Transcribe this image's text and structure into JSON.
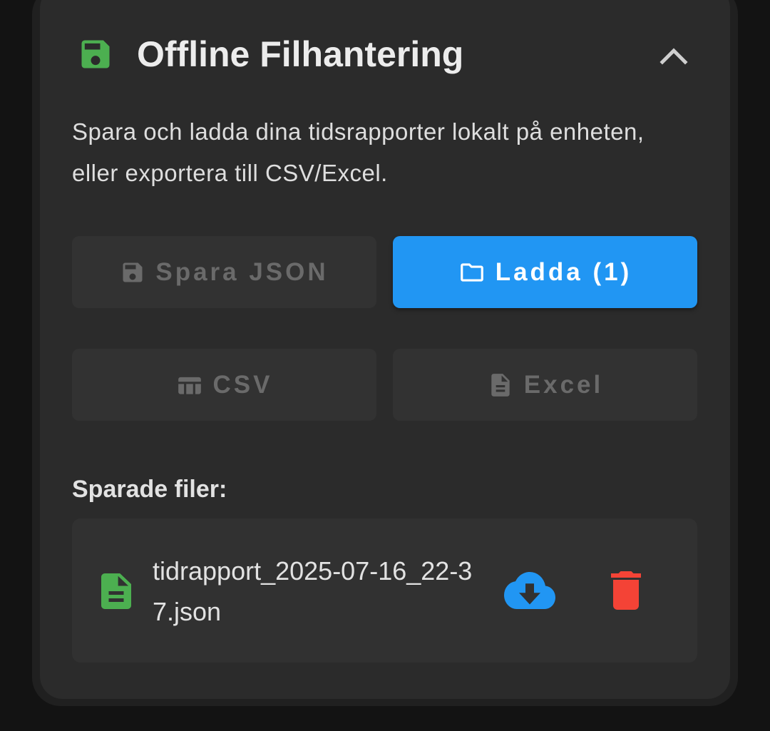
{
  "panel": {
    "title": "Offline Filhantering",
    "description": "Spara och ladda dina tidsrapporter lokalt på enheten, eller exportera till CSV/Excel.",
    "header_icon": "floppy-disk-icon",
    "collapse_icon": "chevron-up-icon"
  },
  "buttons": {
    "save_json": {
      "label": "Spara JSON",
      "icon": "floppy-disk-icon",
      "state": "disabled"
    },
    "load": {
      "label": "Ladda (1)",
      "icon": "folder-icon",
      "state": "enabled"
    },
    "csv": {
      "label": "CSV",
      "icon": "table-icon",
      "state": "disabled"
    },
    "excel": {
      "label": "Excel",
      "icon": "document-icon",
      "state": "disabled"
    }
  },
  "saved_files": {
    "heading": "Sparade filer:",
    "items": [
      {
        "name": "tidrapport_2025-07-16_22-37.json",
        "icon": "file-document-icon",
        "download_icon": "cloud-download-icon",
        "delete_icon": "trash-icon"
      }
    ]
  },
  "colors": {
    "accent_blue": "#2196f3",
    "green": "#4caf50",
    "red": "#f44336",
    "card_background": "#2b2b2b",
    "page_background": "#131313"
  }
}
